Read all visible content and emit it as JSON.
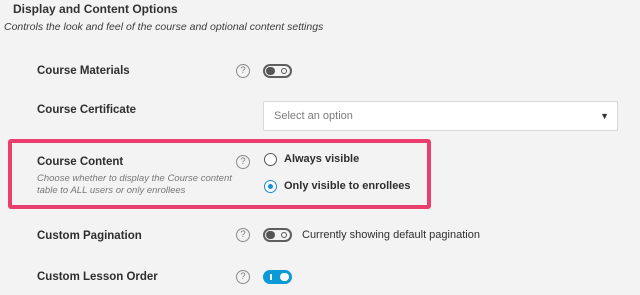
{
  "section": {
    "title": "Display and Content Options",
    "description": "Controls the look and feel of the course and optional content settings"
  },
  "help_glyph": "?",
  "rows": {
    "course_materials": {
      "label": "Course Materials",
      "toggle_on": false
    },
    "course_certificate": {
      "label": "Course Certificate",
      "select_placeholder": "Select an option",
      "caret": "▼"
    },
    "course_content": {
      "label": "Course Content",
      "help": "Choose whether to display the Course content table to ALL users or only enrollees",
      "options": [
        "Always visible",
        "Only visible to enrollees"
      ],
      "selected": "Only visible to enrollees"
    },
    "custom_pagination": {
      "label": "Custom Pagination",
      "toggle_on": false,
      "status_text": "Currently showing default pagination"
    },
    "custom_lesson_order": {
      "label": "Custom Lesson Order",
      "toggle_on": true
    }
  },
  "colors": {
    "highlight": "#ea3e6f",
    "accent": "#0a9ad6",
    "background": "#f3f3f3"
  }
}
